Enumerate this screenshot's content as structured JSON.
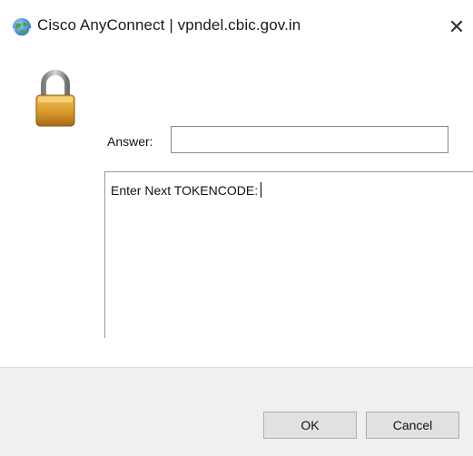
{
  "window": {
    "title": "Cisco AnyConnect | vpndel.cbic.gov.in",
    "close_symbol": "✕",
    "app_icon": "cisco-anyconnect-globe-icon"
  },
  "body": {
    "lock_icon": "padlock-icon",
    "answer_label": "Answer:",
    "answer_value": "",
    "prompt_text": "Enter Next TOKENCODE:"
  },
  "footer": {
    "ok_label": "OK",
    "cancel_label": "Cancel"
  },
  "colors": {
    "footer_bg": "#f0f0f0",
    "button_bg": "#e1e1e1",
    "lock_gold": "#d89a2a",
    "lock_shackle": "#9a9a9a"
  }
}
